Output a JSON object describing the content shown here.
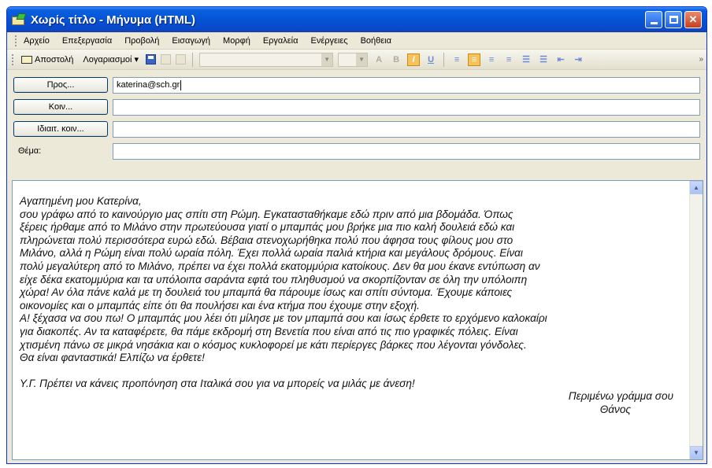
{
  "window": {
    "title": "Χωρίς τίτλο - Μήνυμα (HTML)"
  },
  "menu": [
    "Αρχείο",
    "Επεξεργασία",
    "Προβολή",
    "Εισαγωγή",
    "Μορφή",
    "Εργαλεία",
    "Ενέργειες",
    "Βοήθεια"
  ],
  "toolbar": {
    "send_label": "Αποστολή",
    "accounts_label": "Λογαριασμοί ▾"
  },
  "headers": {
    "to_label": "Προς...",
    "to_value": "katerina@sch.gr",
    "cc_label": "Κοιν...",
    "cc_value": "",
    "bcc_label": "Ιδιαιτ. κοιν...",
    "bcc_value": "",
    "subject_label": "Θέμα:",
    "subject_value": ""
  },
  "body": {
    "lines": [
      "Αγαπημένη μου Κατερίνα,",
      "σου γράφω από το καινούργιο μας σπίτι στη Ρώμη. Εγκατασταθήκαμε εδώ πριν από μια βδομάδα. Όπως",
      "ξέρεις ήρθαμε από το Μιλάνο  στην πρωτεύουσα γιατί ο μπαμπάς μου βρήκε μια πιο καλή δουλειά εδώ και",
      "πληρώνεται πολύ περισσότερα ευρώ εδώ. Βέβαια στενοχωρήθηκα πολύ που άφησα τους φίλους μου στο",
      "Μιλάνο, αλλά η Ρώμη είναι πολύ ωραία πόλη. Έχει πολλά ωραία παλιά κτήρια και μεγάλους δρόμους. Είναι",
      "πολύ μεγαλύτερη από το Μιλάνο, πρέπει να έχει πολλά εκατομμύρια κατοίκους. Δεν θα μου έκανε εντύπωση αν",
      "είχε δέκα εκατομμύρια και τα υπόλοιπα σαράντα εφτά  του πληθυσμού να σκορπίζονταν σε όλη την υπόλοιπη",
      "χώρα! Αν όλα πάνε καλά με τη δουλειά του μπαμπά  θα πάρουμε ίσως και σπίτι σύντομα. Έχουμε κάποιες",
      "οικονομίες και ο μπαμπάς είπε ότι θα πουλήσει και ένα κτήμα που έχουμε στην εξοχή.",
      "Α! ξέχασα να σου πω! Ο μπαμπάς μου λέει ότι μίλησε με τον μπαμπά σου και ίσως έρθετε το ερχόμενο καλοκαίρι",
      "για διακοπές. Αν τα καταφέρετε, θα πάμε εκδρομή στη Βενετία που είναι από τις πιο γραφικές πόλεις. Είναι",
      "χτισμένη πάνω σε μικρά νησάκια και ο κόσμος κυκλοφορεί με κάτι περίεργες βάρκες που λέγονται γόνδολες.",
      "Θα είναι φανταστικά! Ελπίζω να έρθετε!"
    ],
    "postscript": "Υ.Γ. Πρέπει να κάνεις προπόνηση στα Ιταλικά σου για να μπορείς να μιλάς με άνεση!",
    "closing": "Περιμένω γράμμα σου",
    "signature": "Θάνος"
  },
  "icons": {
    "app": "mail-envelope-icon",
    "send": "send-envelope-icon",
    "save": "floppy-disk-icon",
    "attach": "paperclip-icon"
  }
}
